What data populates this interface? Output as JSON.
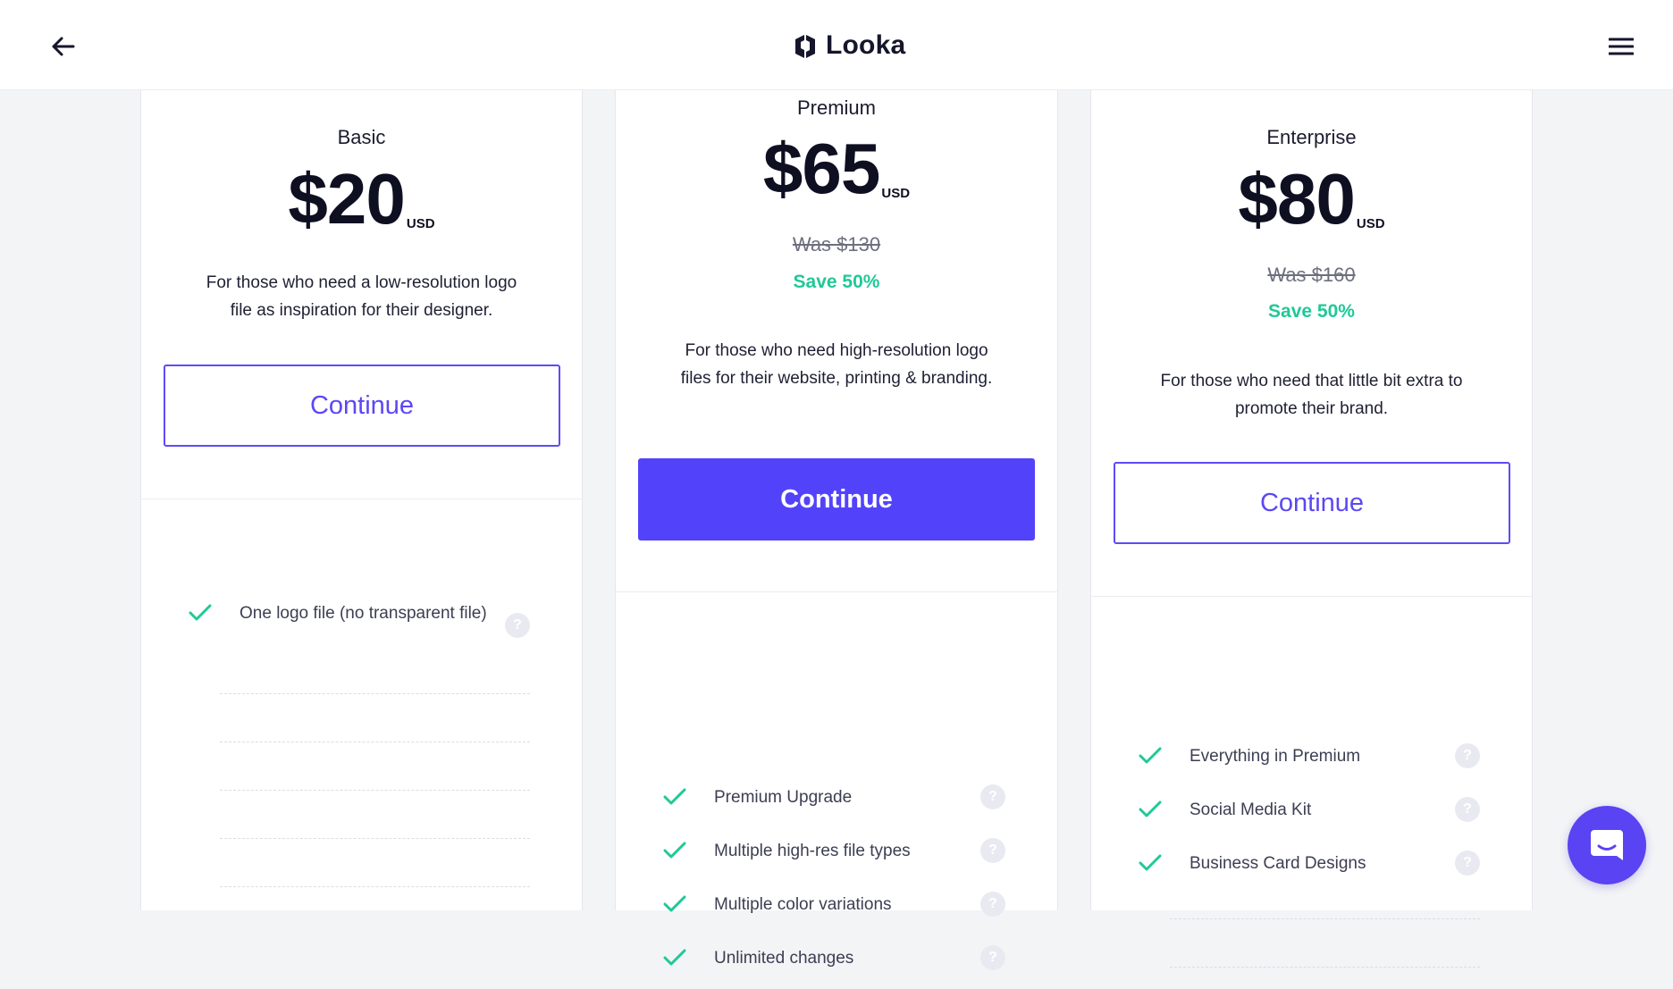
{
  "header": {
    "back_icon": "arrow-left-icon",
    "brand_icon": "looka-logo-icon",
    "brand_name": "Looka",
    "menu_icon": "hamburger-menu-icon"
  },
  "plans": [
    {
      "name": "Basic",
      "price": "$20",
      "currency": "USD",
      "description": "For those who need a low-resolution logo file as inspiration for their designer.",
      "cta": "Continue",
      "features": [
        "One logo file (no transparent file)"
      ]
    },
    {
      "name": "Premium",
      "price": "$65",
      "currency": "USD",
      "was_price": "Was $130",
      "save": "Save 50%",
      "description": "For those who need high-resolution logo files for their website, printing & branding.",
      "cta": "Continue",
      "features": [
        "Premium Upgrade",
        "Multiple high-res file types",
        "Multiple color variations",
        "Unlimited changes"
      ]
    },
    {
      "name": "Enterprise",
      "price": "$80",
      "currency": "USD",
      "was_price": "Was $160",
      "save": "Save 50%",
      "description": "For those who need that little bit extra to promote their brand.",
      "cta": "Continue",
      "features": [
        "Everything in Premium",
        "Social Media Kit",
        "Business Card Designs"
      ]
    }
  ],
  "icons": {
    "check": "check-icon",
    "help": "question-circle-icon",
    "chat": "chat-bubble-icon"
  },
  "colors": {
    "accent": "#5243fb",
    "save_green": "#20c997",
    "check_green": "#20c997"
  }
}
